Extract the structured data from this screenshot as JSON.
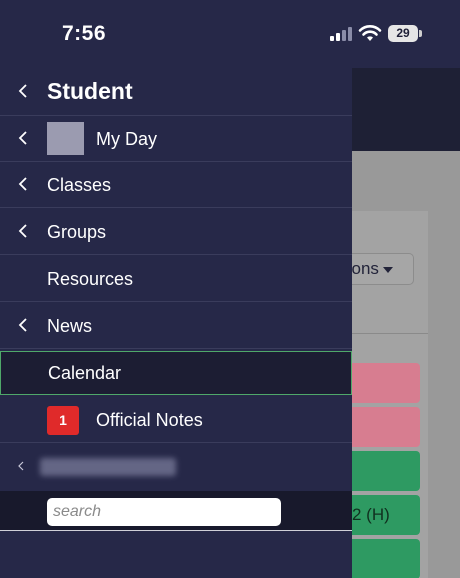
{
  "status_bar": {
    "time": "7:56",
    "battery_level": "29"
  },
  "background_page": {
    "options_button": "tions",
    "cells": [
      {
        "color": "#d77d90",
        "text": ""
      },
      {
        "color": "#d77d90",
        "text": ""
      },
      {
        "color": "#2e9a62",
        "text": ""
      },
      {
        "color": "#2e9a62",
        "text": "2 (H)"
      },
      {
        "color": "#2e9a62",
        "text": ""
      }
    ]
  },
  "drawer": {
    "title": "Student",
    "items": [
      {
        "label": "My Day"
      },
      {
        "label": "Classes"
      },
      {
        "label": "Groups"
      },
      {
        "label": "Resources"
      },
      {
        "label": "News"
      },
      {
        "label": "Calendar"
      },
      {
        "label": "Official Notes",
        "badge": "1"
      }
    ],
    "search": {
      "placeholder": "search"
    }
  },
  "colors": {
    "drawer_bg": "#262848",
    "selected_bg": "#1c1d33",
    "selected_border": "#4fa86a",
    "badge": "#e02a2a"
  }
}
